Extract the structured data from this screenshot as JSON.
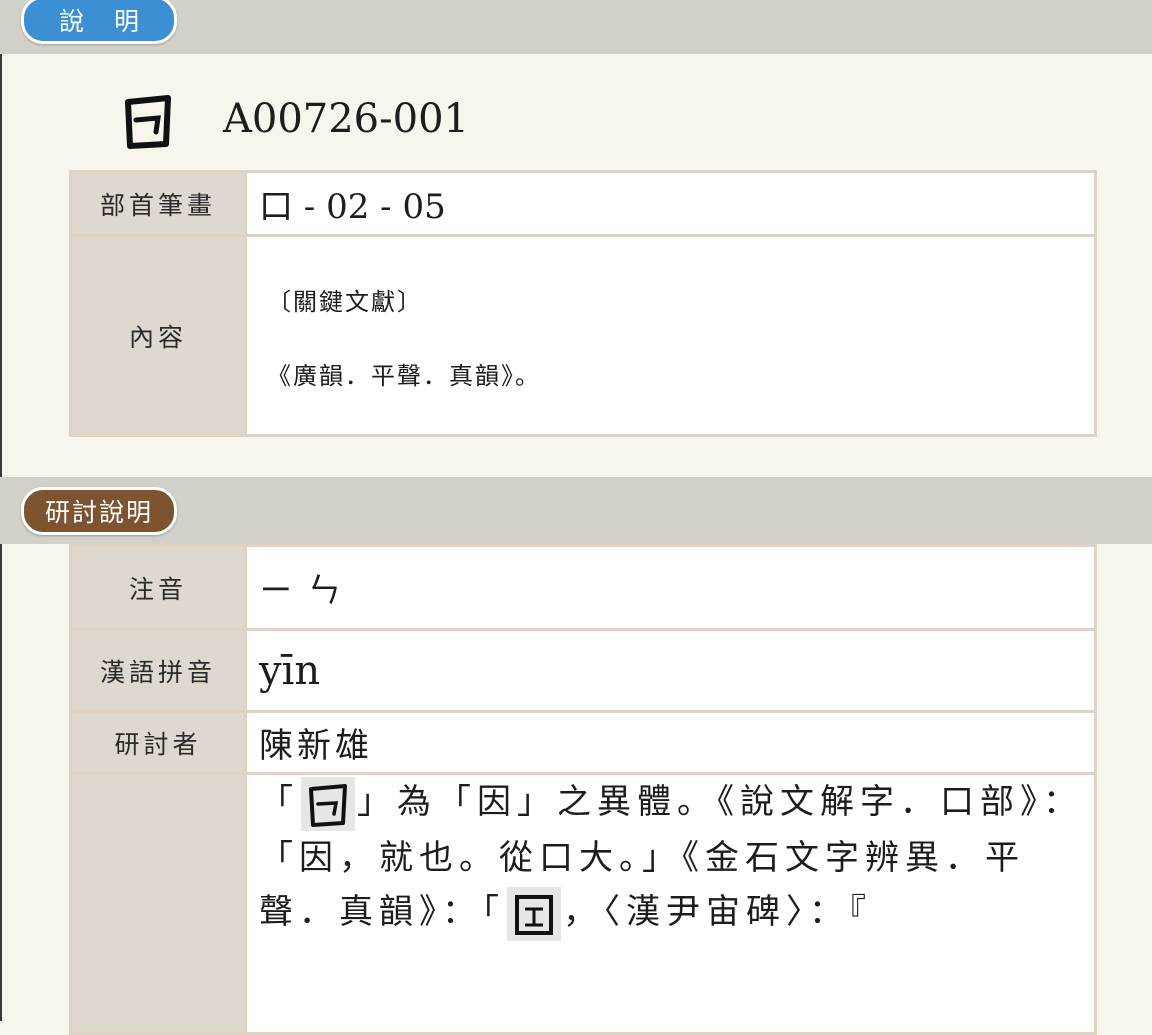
{
  "sections": {
    "explanation_label": "說明",
    "revision_label": "研討說明"
  },
  "header": {
    "code": "A00726-001",
    "glyph_icon": "variant-glyph-icon"
  },
  "info_table": {
    "radical_label": "部首筆畫",
    "radical_value": "口 - 02 - 05",
    "content_label": "內容",
    "content_lines": [
      "〔關鍵文獻〕",
      "《廣韻．平聲．真韻》。"
    ]
  },
  "revision_table": {
    "zhuyin_label": "注音",
    "zhuyin_value": "ㄧㄣ",
    "pinyin_label": "漢語拼音",
    "pinyin_value": "yīn",
    "reviewer_label": "研討者",
    "reviewer_value": "陳新雄",
    "description_segments": [
      "「",
      "」為「因」之異體。《說文解字．口部》：「因，就也。從口大。」《金石文字辨異．平聲．真韻》：「",
      "，〈漢尹宙碑〉：『"
    ]
  },
  "colors": {
    "section_bar": "#d1d0c9",
    "page_bg": "#f8f6ec",
    "label_cell": "#ded8cf",
    "border": "#dfd3c3",
    "pill_blue": "#3d8fd4",
    "pill_brown": "#7e5430"
  }
}
